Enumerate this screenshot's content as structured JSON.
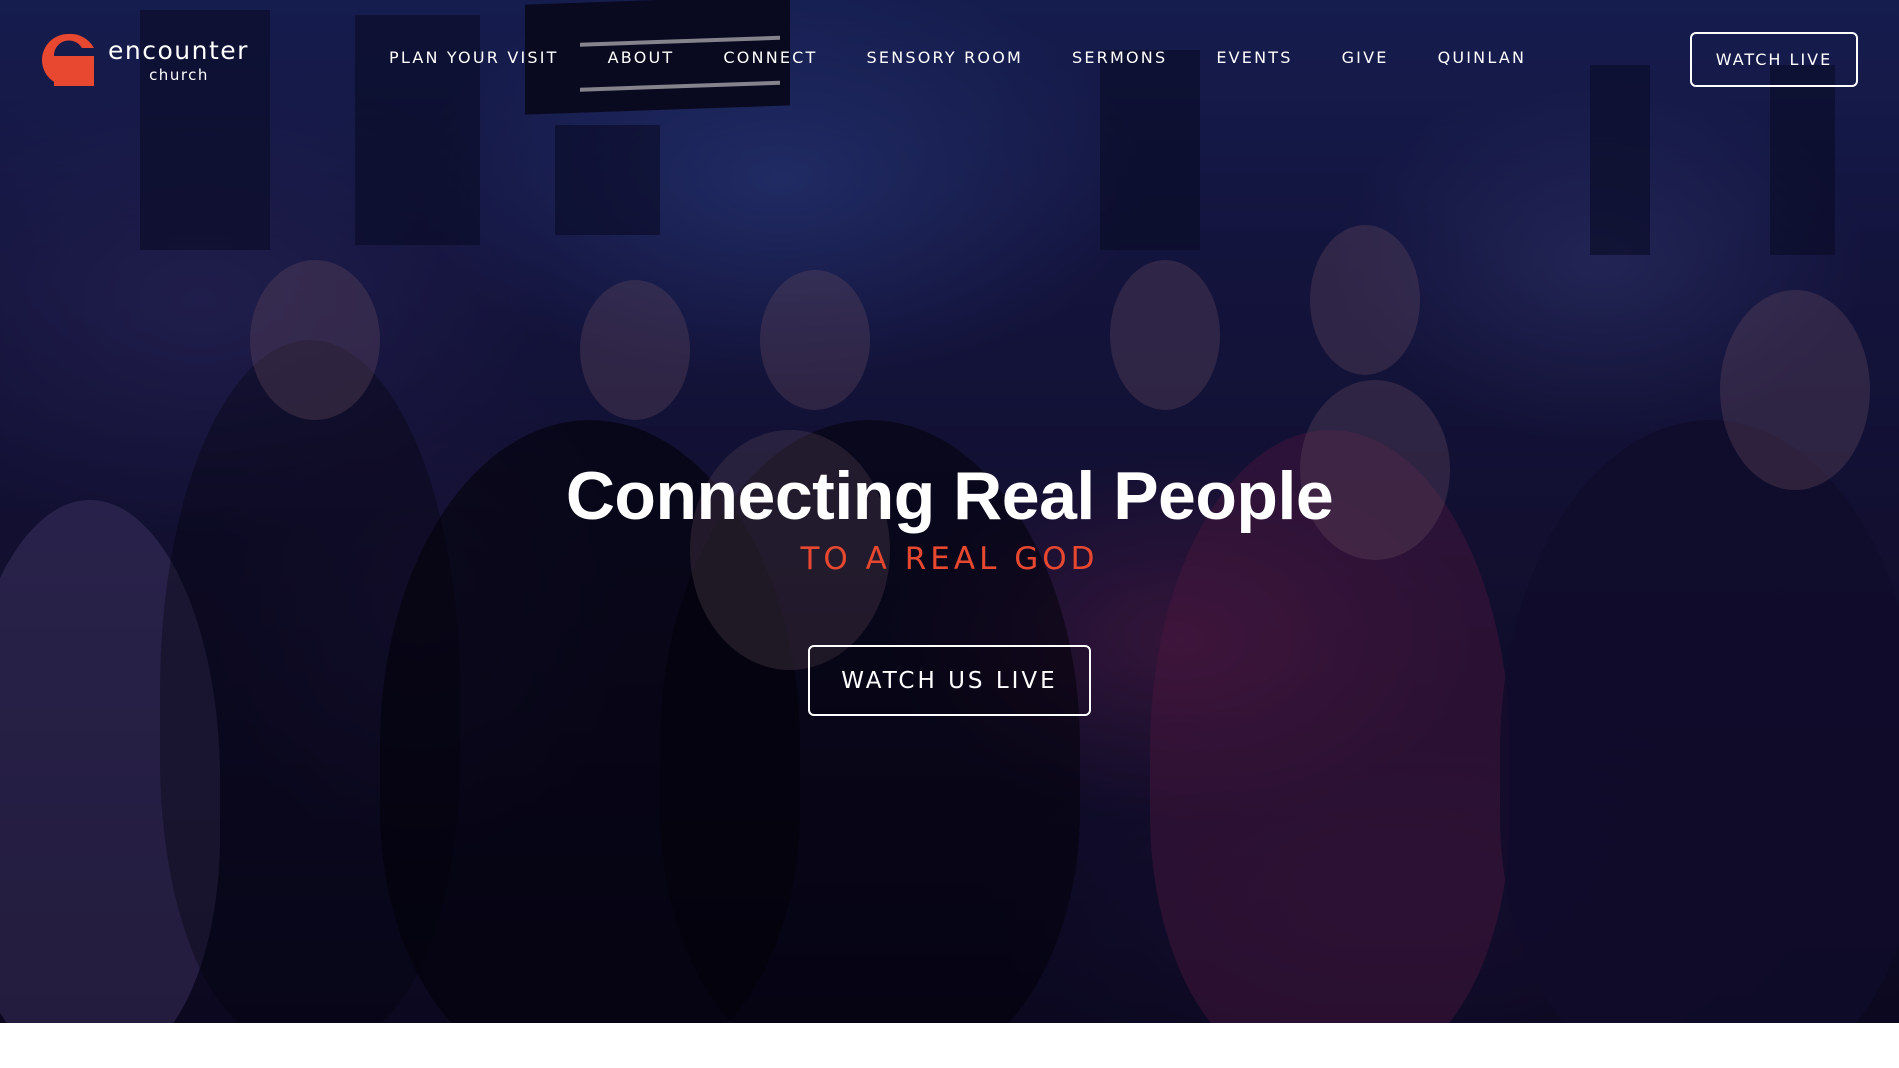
{
  "brand": {
    "name": "encounter",
    "sub": "church",
    "accent_color": "#e8482f",
    "logo_icon": "encounter-e-logo-icon"
  },
  "nav": {
    "items": [
      {
        "label": "PLAN YOUR VISIT"
      },
      {
        "label": "ABOUT"
      },
      {
        "label": "CONNECT"
      },
      {
        "label": "SENSORY ROOM"
      },
      {
        "label": "SERMONS"
      },
      {
        "label": "EVENTS"
      },
      {
        "label": "GIVE"
      },
      {
        "label": "QUINLAN"
      }
    ],
    "watch_live_label": "WATCH LIVE"
  },
  "hero": {
    "title": "Connecting Real People",
    "subtitle": "TO A REAL GOD",
    "cta_label": "WATCH US LIVE",
    "background": "worship-congregation-photo"
  }
}
